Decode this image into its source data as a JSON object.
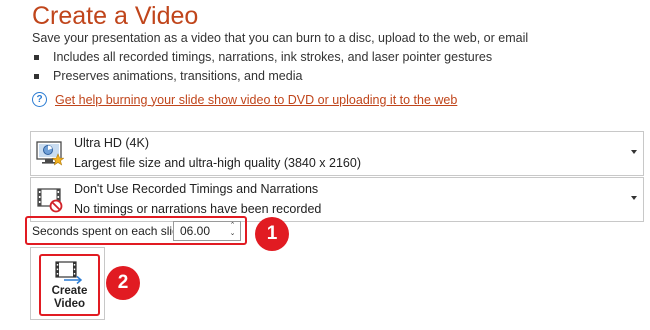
{
  "header": {
    "title": "Create a Video",
    "description": "Save your presentation as a video that you can burn to a disc, upload to the web, or email"
  },
  "bullets": [
    "Includes all recorded timings, narrations, ink strokes, and laser pointer gestures",
    "Preserves animations, transitions, and media"
  ],
  "help_link": "Get help burning your slide show video to DVD or uploading it to the web",
  "quality_dropdown": {
    "title": "Ultra HD (4K)",
    "subtitle": "Largest file size and ultra-high quality (3840 x 2160)"
  },
  "timings_dropdown": {
    "title": "Don't Use Recorded Timings and Narrations",
    "subtitle": "No timings or narrations have been recorded"
  },
  "seconds": {
    "label": "Seconds spent on each slide:",
    "value": "06.00"
  },
  "create_button": {
    "line1": "Create",
    "line2": "Video"
  },
  "annotations": [
    "1",
    "2"
  ],
  "colors": {
    "accent": "#c0451b",
    "highlight": "#e11b22",
    "info_icon": "#2b7cd3"
  }
}
